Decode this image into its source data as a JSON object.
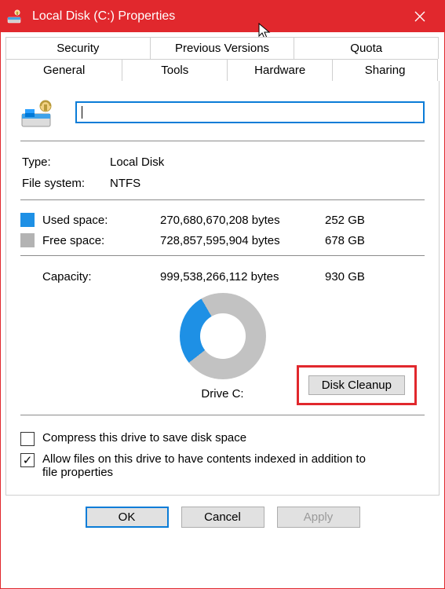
{
  "window": {
    "title": "Local Disk (C:) Properties"
  },
  "tabs_top": [
    "Security",
    "Previous Versions",
    "Quota"
  ],
  "tabs_bottom": [
    "General",
    "Tools",
    "Hardware",
    "Sharing"
  ],
  "active_tab": "General",
  "general": {
    "volume_label": "",
    "type_label": "Type:",
    "type_value": "Local Disk",
    "fs_label": "File system:",
    "fs_value": "NTFS",
    "used_label": "Used space:",
    "used_bytes": "270,680,670,208 bytes",
    "used_gb": "252 GB",
    "free_label": "Free space:",
    "free_bytes": "728,857,595,904 bytes",
    "free_gb": "678 GB",
    "capacity_label": "Capacity:",
    "capacity_bytes": "999,538,266,112 bytes",
    "capacity_gb": "930 GB",
    "drive_caption": "Drive C:",
    "disk_cleanup": "Disk Cleanup",
    "checkbox_compress": "Compress this drive to save disk space",
    "checkbox_index": "Allow files on this drive to have contents indexed in addition to file properties",
    "compress_checked": false,
    "index_checked": true
  },
  "buttons": {
    "ok": "OK",
    "cancel": "Cancel",
    "apply": "Apply"
  },
  "chart_data": {
    "type": "pie",
    "title": "Drive C:",
    "series": [
      {
        "name": "Used space",
        "value_bytes": 270680670208,
        "value_gb": 252,
        "color": "#1e90e5"
      },
      {
        "name": "Free space",
        "value_bytes": 728857595904,
        "value_gb": 678,
        "color": "#c2c2c2"
      }
    ],
    "total_bytes": 999538266112,
    "total_gb": 930
  }
}
